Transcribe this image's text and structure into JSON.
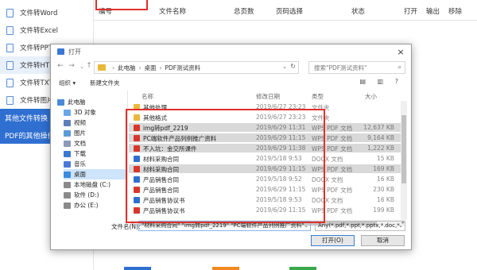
{
  "app": {
    "sidebar_items": [
      {
        "label": "文件转Word",
        "sel": false
      },
      {
        "label": "文件转Excel",
        "sel": false
      },
      {
        "label": "文件转PPT",
        "sel": false
      },
      {
        "label": "文件转HTML",
        "sel": true
      },
      {
        "label": "文件转TXT",
        "sel": false
      },
      {
        "label": "文件转图片",
        "sel": false
      }
    ],
    "sidebar_groups": [
      "其他文件转换",
      "PDF的其他操作"
    ],
    "table_headers": [
      "编号",
      "文件名称",
      "总页数",
      "页码选择",
      "状态",
      "打开",
      "输出",
      "移除"
    ]
  },
  "dialog": {
    "title": "打开",
    "close": "×",
    "address": [
      "此电脑",
      "桌面",
      "PDF测试资料"
    ],
    "search_placeholder": "搜索\"PDF测试资料\"",
    "toolbar": {
      "organize": "组织 ▾",
      "new_folder": "新建文件夹"
    },
    "tree": [
      {
        "label": "此电脑",
        "color": "#4a8ad8",
        "indent": 0,
        "sel": false
      },
      {
        "label": "3D 对象",
        "color": "#6aa7e8",
        "indent": 1,
        "sel": false
      },
      {
        "label": "视频",
        "color": "#5b7fb8",
        "indent": 1,
        "sel": false
      },
      {
        "label": "图片",
        "color": "#5b9bd8",
        "indent": 1,
        "sel": false
      },
      {
        "label": "文档",
        "color": "#8a9ab8",
        "indent": 1,
        "sel": false
      },
      {
        "label": "下载",
        "color": "#3a7ad0",
        "indent": 1,
        "sel": false
      },
      {
        "label": "音乐",
        "color": "#4a7ad8",
        "indent": 1,
        "sel": false
      },
      {
        "label": "桌面",
        "color": "#3a8ae0",
        "indent": 1,
        "sel": true
      },
      {
        "label": "本地磁盘 (C:)",
        "color": "#8a8a8a",
        "indent": 1,
        "sel": false
      },
      {
        "label": "软件 (D:)",
        "color": "#8a8a8a",
        "indent": 1,
        "sel": false
      },
      {
        "label": "办公 (E:)",
        "color": "#8a8a8a",
        "indent": 1,
        "sel": false
      }
    ],
    "list_headers": {
      "name": "名称",
      "date": "修改日期",
      "type": "类型",
      "size": "大小"
    },
    "files": [
      {
        "name": "其他处理",
        "date": "2019/6/27 23:23",
        "type": "文件夹",
        "size": "",
        "icon": "#e9b83a",
        "sel": false
      },
      {
        "name": "其他格式",
        "date": "2019/6/27 23:23",
        "type": "文件夹",
        "size": "",
        "icon": "#e9b83a",
        "sel": false
      },
      {
        "name": "img转pdf_2219",
        "date": "2019/6/29 11:31",
        "type": "WPS PDF 文档",
        "size": "12,637 KB",
        "icon": "#d9362b",
        "sel": true
      },
      {
        "name": "PC端软件产品列例推广资料",
        "date": "2019/6/29 11:15",
        "type": "WPS PDF 文档",
        "size": "9,164 KB",
        "icon": "#d9362b",
        "sel": true
      },
      {
        "name": "不入坑：金交所课件",
        "date": "2019/6/29 11:38",
        "type": "WPS PDF 文档",
        "size": "1,222 KB",
        "icon": "#d9362b",
        "sel": true
      },
      {
        "name": "材料采购合同",
        "date": "2019/5/18 9:53",
        "type": "DOCX 文档",
        "size": "15 KB",
        "icon": "#2f6fd1",
        "sel": false
      },
      {
        "name": "材料采购合同",
        "date": "2019/6/29 11:15",
        "type": "WPS PDF 文档",
        "size": "169 KB",
        "icon": "#d9362b",
        "sel": true
      },
      {
        "name": "产品销售合同",
        "date": "2019/5/18 9:52",
        "type": "DOCX 文档",
        "size": "16 KB",
        "icon": "#2f6fd1",
        "sel": false
      },
      {
        "name": "产品销售合同",
        "date": "2019/6/29 11:15",
        "type": "WPS PDF 文档",
        "size": "230 KB",
        "icon": "#d9362b",
        "sel": false
      },
      {
        "name": "产品销售协议书",
        "date": "2019/5/18 9:53",
        "type": "DOCX 文档",
        "size": "16 KB",
        "icon": "#2f6fd1",
        "sel": false
      },
      {
        "name": "产品销售协议书",
        "date": "2019/6/29 11:15",
        "type": "WPS PDF 文档",
        "size": "199 KB",
        "icon": "#d9362b",
        "sel": false
      }
    ],
    "filename_label": "文件名(N):",
    "filename_value": "\"材料采购合同\" \"img转pdf_2219\" \"PC端软件产品列例推广资料\"",
    "filetype_value": "Any(*.pdf,*.ppt,*.pptx,*.doc,*",
    "open_button": "打开(O)",
    "cancel_button": "取消",
    "red_box_color": "#e0302b"
  }
}
